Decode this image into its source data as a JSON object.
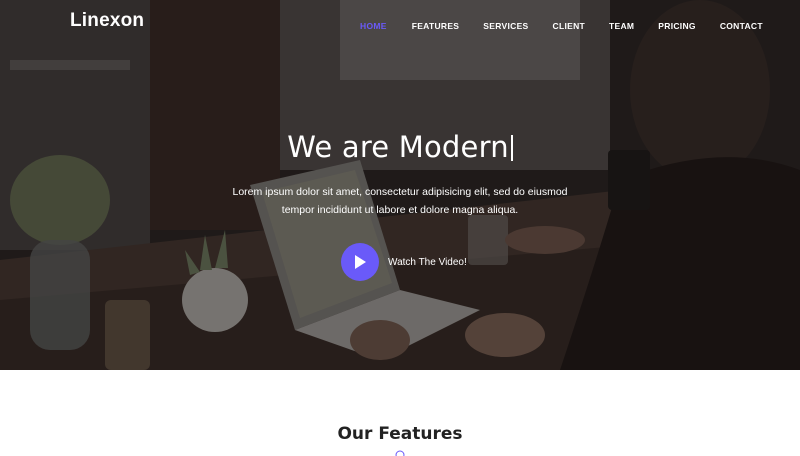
{
  "brand": {
    "name": "Linexon"
  },
  "nav": {
    "items": [
      {
        "label": "Home",
        "active": true
      },
      {
        "label": "Features",
        "active": false
      },
      {
        "label": "Services",
        "active": false
      },
      {
        "label": "Client",
        "active": false
      },
      {
        "label": "Team",
        "active": false
      },
      {
        "label": "Pricing",
        "active": false
      },
      {
        "label": "Contact",
        "active": false
      }
    ]
  },
  "hero": {
    "title": "We are Modern",
    "subtitle_line1": "Lorem ipsum dolor sit amet, consectetur adipisicing elit, sed do eiusmod",
    "subtitle_line2": "tempor incididunt ut labore et dolore magna aliqua.",
    "video_label": "Watch The Video!",
    "play_icon": "play-icon"
  },
  "features": {
    "title_light": "Our",
    "title_bold": "Features"
  },
  "colors": {
    "accent": "#6a5af9",
    "hero_overlay": "#120e0e",
    "text_dark": "#222222"
  }
}
